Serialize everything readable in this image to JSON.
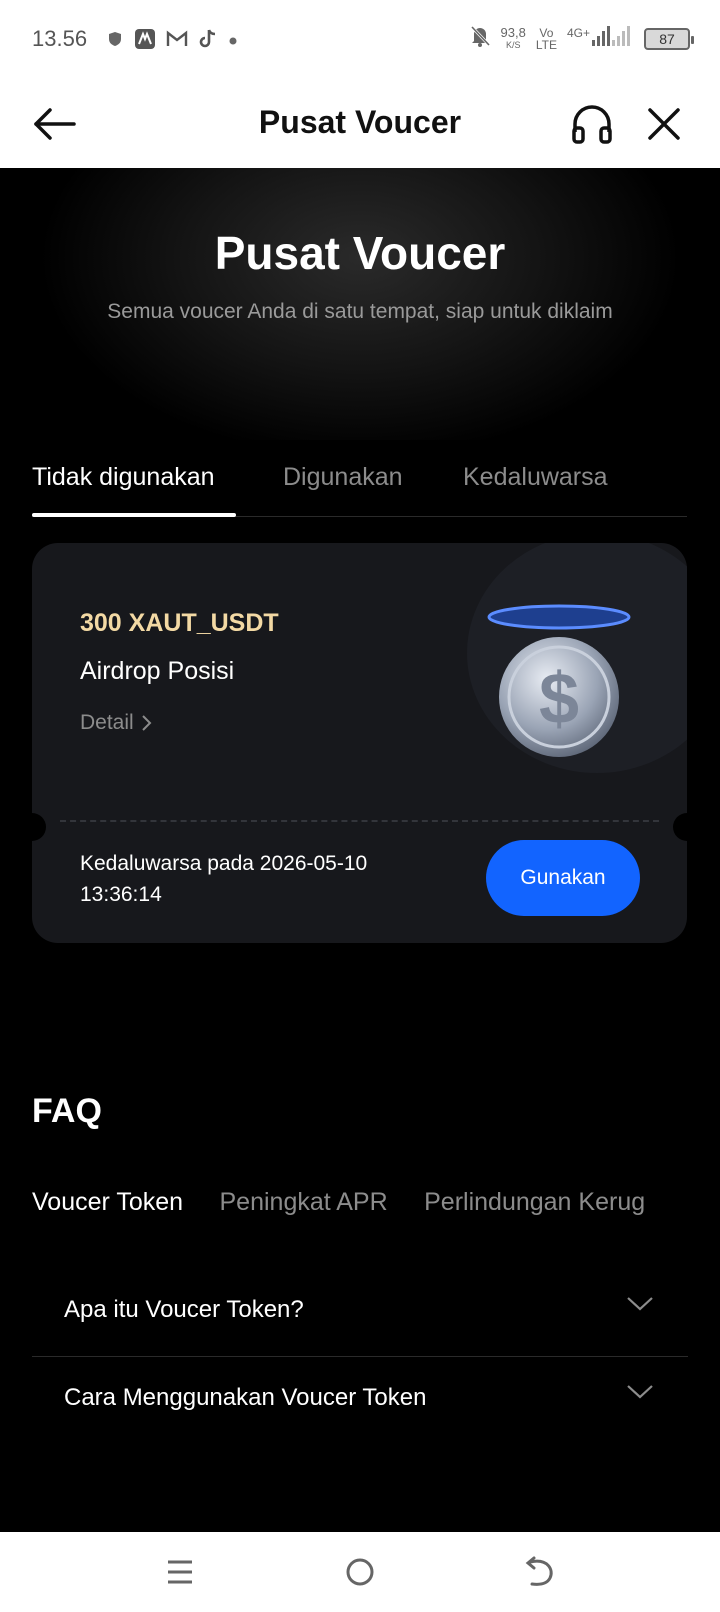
{
  "status_bar": {
    "time": "13.56",
    "net_speed_value": "93,8",
    "net_speed_unit": "K/S",
    "volte_top": "Vo",
    "volte_bottom": "LTE",
    "network": "4G+",
    "battery": "87"
  },
  "app_bar": {
    "title": "Pusat Voucer"
  },
  "hero": {
    "title": "Pusat Voucer",
    "subtitle": "Semua voucer Anda di satu tempat, siap untuk diklaim"
  },
  "tabs": [
    {
      "label": "Tidak digunakan",
      "active": true
    },
    {
      "label": "Digunakan",
      "active": false
    },
    {
      "label": "Kedaluwarsa",
      "active": false
    }
  ],
  "voucher": {
    "amount": "300 XAUT_USDT",
    "title": "Airdrop Posisi",
    "detail_label": "Detail",
    "expiry_line1": "Kedaluwarsa pada 2026-05-10",
    "expiry_line2": "13:36:14",
    "use_button": "Gunakan",
    "coin_symbol": "$"
  },
  "faq": {
    "title": "FAQ",
    "tabs": [
      {
        "label": "Voucer Token",
        "active": true
      },
      {
        "label": "Peningkat APR",
        "active": false
      },
      {
        "label": "Perlindungan Kerug",
        "active": false
      }
    ],
    "items": [
      {
        "question": "Apa itu Voucer Token?"
      },
      {
        "question": "Cara Menggunakan Voucer Token"
      }
    ]
  },
  "colors": {
    "accent": "#1264ff",
    "amount": "#f3d9a4",
    "card_bg": "#17181c"
  },
  "icons": {
    "back": "arrow-left-icon",
    "support": "headset-icon",
    "close": "close-icon",
    "detail": "chevron-right-icon",
    "faq_expand": "chevron-down-icon",
    "nav_menu": "menu-icon",
    "nav_home": "home-circle-icon",
    "nav_back": "back-icon"
  }
}
